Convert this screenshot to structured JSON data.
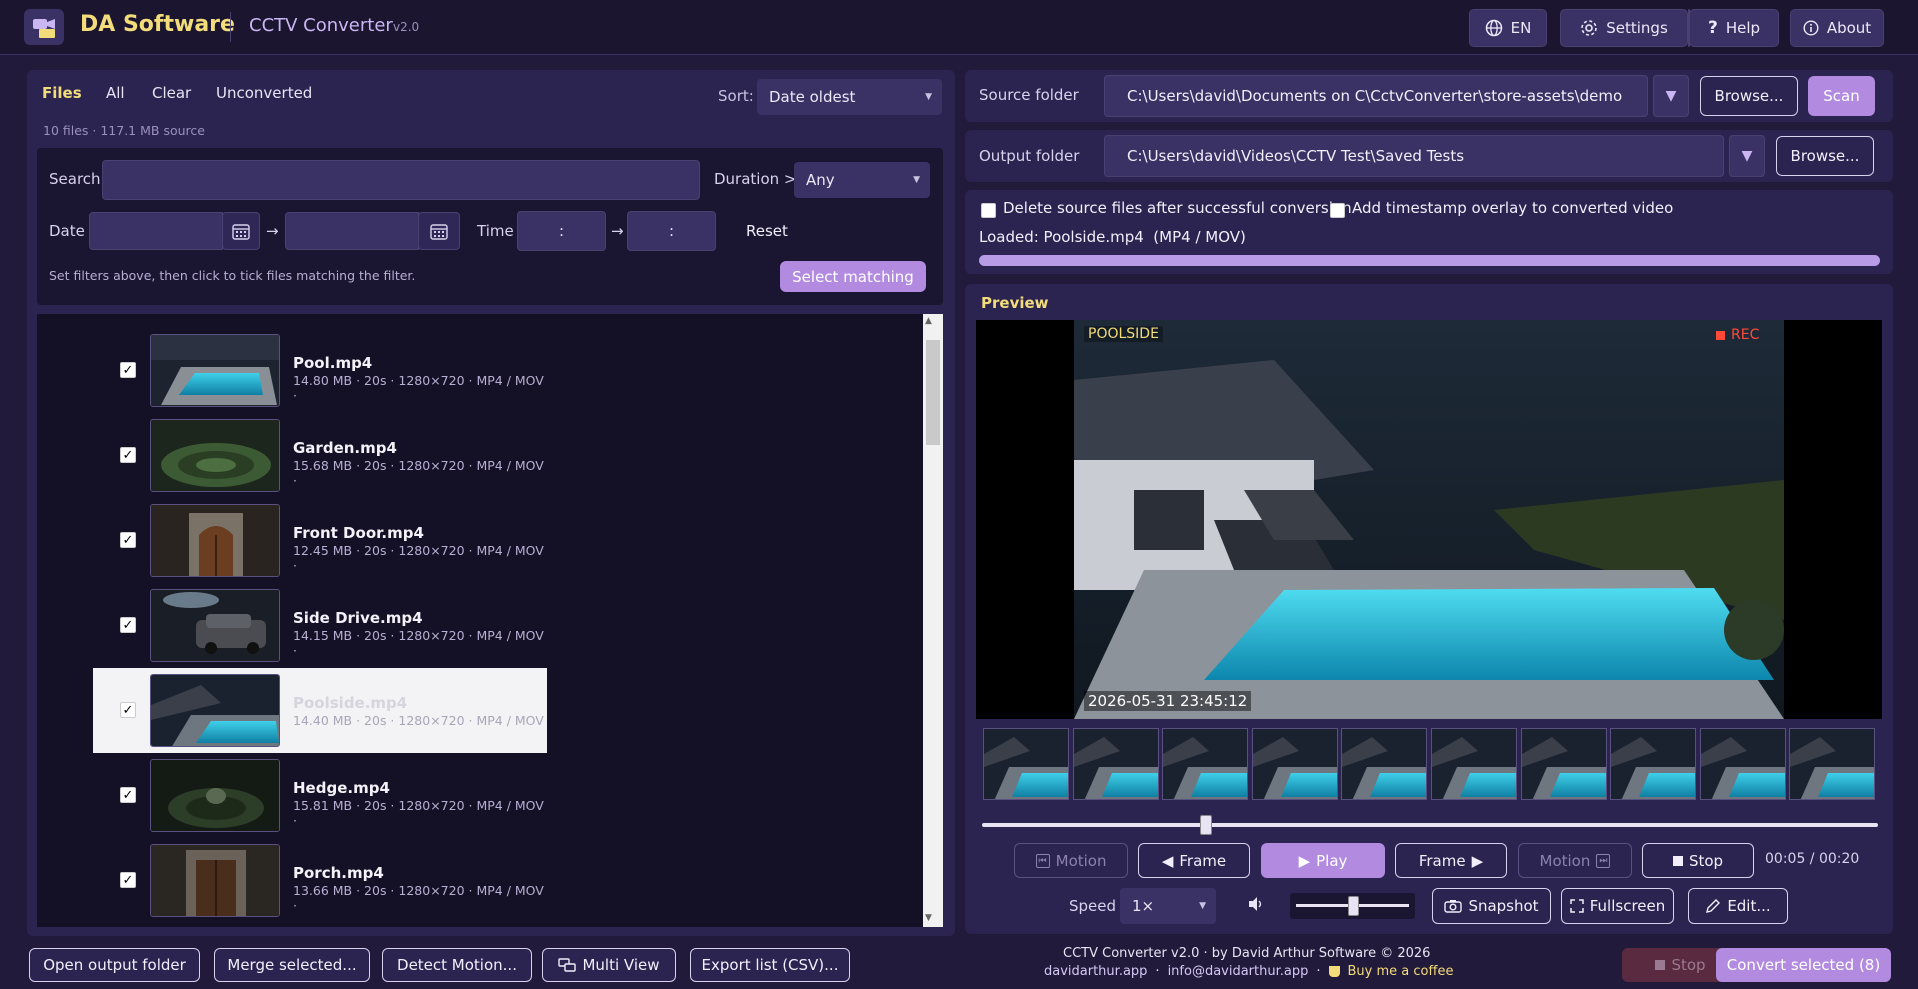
{
  "header": {
    "brand": "DA Software",
    "app_title": "CCTV Converter",
    "version": "v2.0",
    "language": "EN",
    "settings": "Settings",
    "help": "Help",
    "about": "About"
  },
  "files": {
    "tab_files": "Files",
    "tab_all": "All",
    "tab_clear": "Clear",
    "tab_unconverted": "Unconverted",
    "sort_label": "Sort:",
    "sort_value": "Date oldest",
    "summary": "10 files  ·  117.1 MB source",
    "filter": {
      "search_label": "Search",
      "duration_label": "Duration >",
      "duration_value": "Any",
      "date_label": "Date",
      "arrow": "→",
      "time_label": "Time",
      "time_placeholder": ":",
      "reset": "Reset",
      "hint": "Set filters above, then click to tick files matching the filter.",
      "select_matching": "Select matching"
    },
    "items": [
      {
        "name": "Pool.mp4",
        "meta": "14.80 MB · 20s · 1280×720 · MP4 / MOV ·"
      },
      {
        "name": "Garden.mp4",
        "meta": "15.68 MB · 20s · 1280×720 · MP4 / MOV ·"
      },
      {
        "name": "Front Door.mp4",
        "meta": "12.45 MB · 20s · 1280×720 · MP4 / MOV ·"
      },
      {
        "name": "Side Drive.mp4",
        "meta": "14.15 MB · 20s · 1280×720 · MP4 / MOV ·"
      },
      {
        "name": "Poolside.mp4",
        "meta": "14.40 MB · 20s · 1280×720 · MP4 / MOV"
      },
      {
        "name": "Hedge.mp4",
        "meta": "15.81 MB · 20s · 1280×720 · MP4 / MOV ·"
      },
      {
        "name": "Porch.mp4",
        "meta": "13.66 MB · 20s · 1280×720 · MP4 / MOV ·"
      }
    ]
  },
  "source": {
    "label": "Source folder",
    "path": "C:\\Users\\david\\Documents on C\\CctvConverter\\store-assets\\demo",
    "browse": "Browse...",
    "scan": "Scan"
  },
  "output": {
    "label": "Output folder",
    "path": "C:\\Users\\david\\Videos\\CCTV Test\\Saved Tests",
    "browse": "Browse..."
  },
  "options": {
    "delete_source": "Delete source files after successful conversion",
    "timestamp_overlay": "Add timestamp overlay to converted video",
    "loaded": "Loaded: Poolside.mp4  (MP4 / MOV)",
    "progress": 1.0
  },
  "preview": {
    "title": "Preview",
    "camera_label": "POOLSIDE",
    "rec": "REC",
    "timestamp": "2026-05-31 23:45:12",
    "seek_fraction": 0.25,
    "time": "00:05 / 00:20",
    "controls": {
      "motion_prev": "Motion",
      "frame_prev": "Frame",
      "play": "Play",
      "frame_next": "Frame",
      "motion_next": "Motion",
      "stop": "Stop"
    },
    "speed_label": "Speed",
    "speed_value": "1×",
    "volume_fraction": 0.5,
    "snapshot": "Snapshot",
    "fullscreen": "Fullscreen",
    "edit": "Edit..."
  },
  "bottom": {
    "open_output": "Open output folder",
    "merge": "Merge selected...",
    "detect_motion": "Detect Motion...",
    "multi_view": "Multi View",
    "export_list": "Export list (CSV)...",
    "stop": "Stop",
    "convert": "Convert selected (8)"
  },
  "footer": {
    "credit": "CCTV Converter v2.0  ·  by David Arthur Software © 2026",
    "website": "davidarthur.app",
    "sep": "·",
    "email": "info@davidarthur.app",
    "coffee": "Buy me a coffee"
  },
  "colors": {
    "accent": "#b28be0",
    "brand": "#f3dc7a",
    "rec": "#ff4a3a",
    "background": "#211a3a"
  }
}
